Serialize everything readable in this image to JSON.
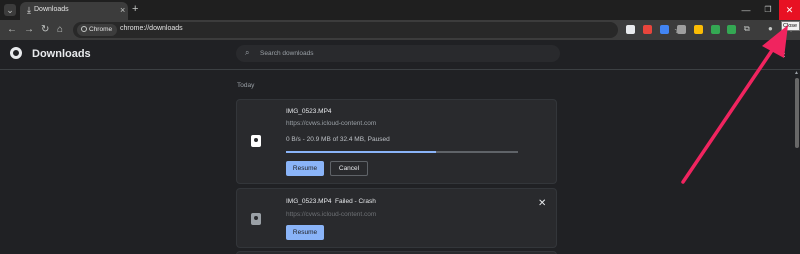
{
  "browser": {
    "tab": {
      "title": "Downloads",
      "close_icon": "×"
    },
    "new_tab_label": "+",
    "window_controls": {
      "minimize": "—",
      "maximize": "❐",
      "close": "✕"
    },
    "close_tooltip": "Close",
    "omnibox": {
      "site_chip": "Chrome",
      "url": "chrome://downloads"
    },
    "extension_colors": [
      "#e8eaed",
      "#e8453c",
      "#4285f4",
      "#9e9e9e",
      "#fbbc04",
      "#34a853",
      "#34a853",
      "#5f6368"
    ]
  },
  "page": {
    "title": "Downloads",
    "search_placeholder": "Search downloads",
    "date_heading": "Today"
  },
  "downloads": [
    {
      "filename": "IMG_0523.MP4",
      "url": "https://cvws.icloud-content.com",
      "progress_text": "0 B/s - 20.9 MB of 32.4 MB, Paused",
      "progress": 0.645,
      "buttons": {
        "resume": "Resume",
        "cancel": "Cancel"
      }
    },
    {
      "filename": "IMG_0523.MP4",
      "status": "Failed - Crash",
      "url": "https://cvws.icloud-content.com",
      "buttons": {
        "resume": "Resume"
      },
      "dismiss_icon": "✕"
    }
  ],
  "colors": {
    "accent": "#8ab4f8",
    "close_red": "#e81123",
    "annotation_arrow": "#f0245f"
  }
}
